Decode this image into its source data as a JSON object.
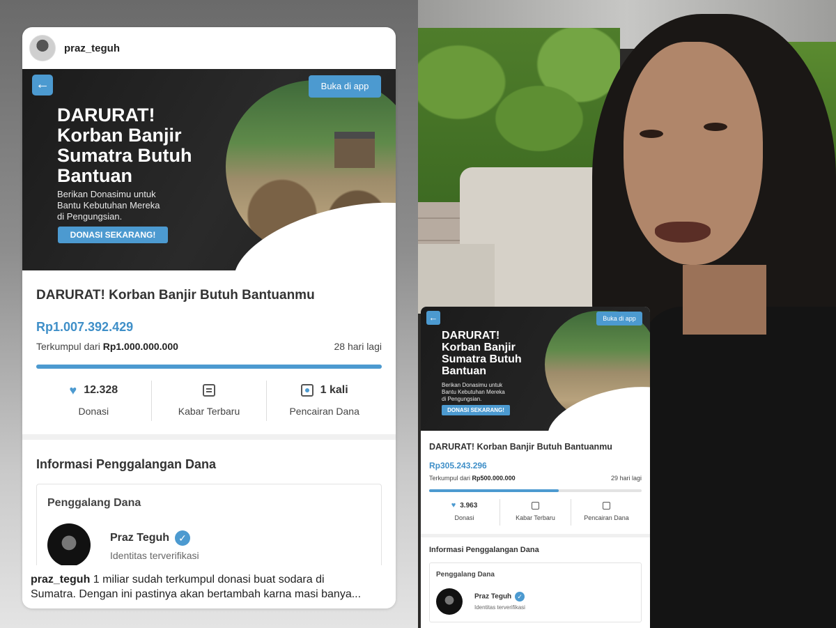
{
  "post": {
    "username": "praz_teguh",
    "caption_user": "praz_teguh",
    "caption_text": " 1 miliar sudah terkumpul donasi buat sodara di\nSumatra. Dengan ini pastinya akan bertambah karna masi banya..."
  },
  "campaign_main": {
    "open_app_label": "Buka di app",
    "back_glyph": "←",
    "banner_title": "DARURAT!\nKorban Banjir\nSumatra Butuh\nBantuan",
    "banner_subtitle": "Berikan Donasimu untuk\nBantu Kebutuhan Mereka\ndi Pengungsian.",
    "banner_cta": "DONASI SEKARANG!",
    "title": "DARURAT! Korban Banjir Butuh Bantuanmu",
    "raised": "Rp1.007.392.429",
    "target_prefix": "Terkumpul dari ",
    "target_amount": "Rp1.000.000.000",
    "days_left": "28 hari lagi",
    "progress": 1.0,
    "stats": {
      "donations_count": "12.328",
      "donations_label": "Donasi",
      "news_label": "Kabar Terbaru",
      "withdraw_count": "1 kali",
      "withdraw_label": "Pencairan Dana"
    },
    "info_title": "Informasi Penggalangan Dana",
    "organizer_label": "Penggalang Dana",
    "organizer_name": "Praz Teguh",
    "organizer_status": "Identitas terverifikasi",
    "verified_glyph": "✓"
  },
  "campaign_mini": {
    "open_app_label": "Buka di app",
    "back_glyph": "←",
    "banner_title": "DARURAT!\nKorban Banjir\nSumatra Butuh\nBantuan",
    "banner_subtitle": "Berikan Donasimu untuk\nBantu Kebutuhan Mereka\ndi Pengungsian.",
    "banner_cta": "DONASI SEKARANG!",
    "title": "DARURAT! Korban Banjir Butuh Bantuanmu",
    "raised": "Rp305.243.296",
    "target_prefix": "Terkumpul dari ",
    "target_amount": "Rp500.000.000",
    "days_left": "29 hari lagi",
    "progress": 0.61,
    "stats": {
      "donations_count": "3.963",
      "donations_label": "Donasi",
      "news_label": "Kabar Terbaru",
      "withdraw_label": "Pencairan Dana"
    },
    "info_title": "Informasi Penggalangan Dana",
    "organizer_label": "Penggalang Dana",
    "organizer_name": "Praz Teguh",
    "organizer_status": "Identitas terverifikasi",
    "verified_glyph": "✓"
  },
  "colors": {
    "accent": "#4c9ad0",
    "amount": "#3f8fc8"
  },
  "icons": [
    "arrow-left-icon",
    "heart-icon",
    "news-icon",
    "withdraw-icon",
    "verified-badge-icon"
  ]
}
